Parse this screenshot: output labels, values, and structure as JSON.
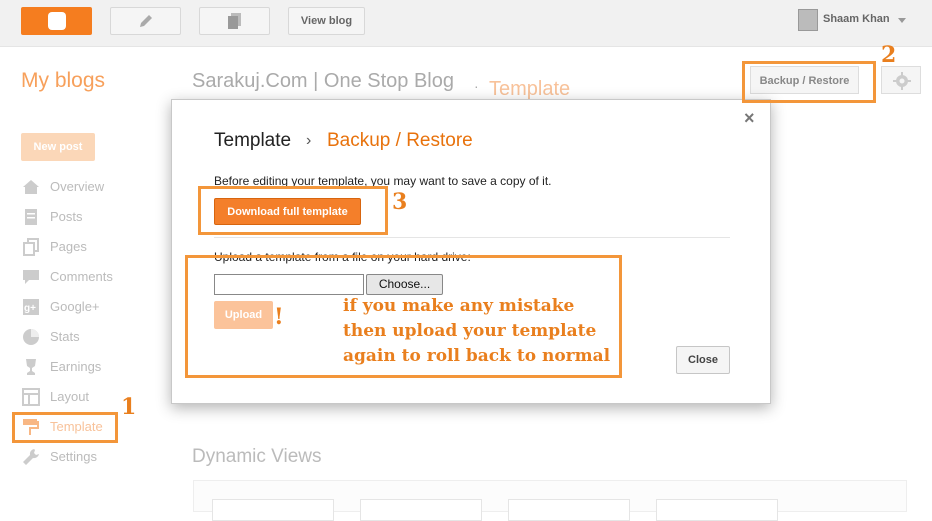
{
  "topbar": {
    "view_blog_label": "View blog",
    "user_name": "Shaam Khan"
  },
  "header": {
    "my_blogs": "My blogs",
    "blog_title": "Sarakuj.Com | One Stop Blog",
    "separator": "·",
    "section": "Template",
    "backup_restore_label": "Backup / Restore"
  },
  "sidebar": {
    "new_post": "New post",
    "items": [
      {
        "label": "Overview",
        "icon": "home-icon"
      },
      {
        "label": "Posts",
        "icon": "document-icon"
      },
      {
        "label": "Pages",
        "icon": "pages-icon"
      },
      {
        "label": "Comments",
        "icon": "comment-icon"
      },
      {
        "label": "Google+",
        "icon": "google-plus-icon"
      },
      {
        "label": "Stats",
        "icon": "pie-chart-icon"
      },
      {
        "label": "Earnings",
        "icon": "trophy-icon"
      },
      {
        "label": "Layout",
        "icon": "layout-icon"
      },
      {
        "label": "Template",
        "icon": "paint-roller-icon",
        "active": true
      },
      {
        "label": "Settings",
        "icon": "wrench-icon"
      }
    ]
  },
  "main": {
    "dynamic_views": "Dynamic Views"
  },
  "modal": {
    "crumb_parent": "Template",
    "crumb_sep": "›",
    "crumb_current": "Backup / Restore",
    "intro_text": "Before editing your template, you may want to save a copy of it.",
    "download_label": "Download full template",
    "upload_text": "Upload a template from a file on your hard drive:",
    "choose_label": "Choose...",
    "upload_label": "Upload",
    "close_label": "Close",
    "close_x": "×"
  },
  "annotations": {
    "n1": "1",
    "n2": "2",
    "n3": "3",
    "exclaim": "!",
    "note_line1": "if you make any mistake",
    "note_line2": "then upload your template",
    "note_line3": "again to roll back to normal"
  },
  "colors": {
    "accent": "#f57d1f",
    "annotation": "#e97f1e",
    "highlight_border": "#f3963a"
  }
}
